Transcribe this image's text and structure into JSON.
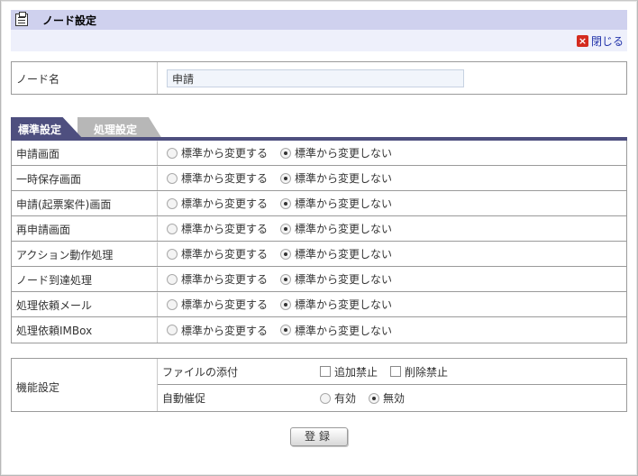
{
  "window": {
    "title": "ノード設定",
    "close_label": "閉じる"
  },
  "node": {
    "label": "ノード名",
    "value": "申請"
  },
  "tabs": [
    {
      "label": "標準設定",
      "active": true
    },
    {
      "label": "処理設定",
      "active": false
    }
  ],
  "standard": {
    "option_change": "標準から変更する",
    "option_nochange": "標準から変更しない",
    "rows": [
      {
        "label": "申請画面",
        "selected": "nochange"
      },
      {
        "label": "一時保存画面",
        "selected": "nochange"
      },
      {
        "label": "申請(起票案件)画面",
        "selected": "nochange"
      },
      {
        "label": "再申請画面",
        "selected": "nochange"
      },
      {
        "label": "アクション動作処理",
        "selected": "nochange"
      },
      {
        "label": "ノード到達処理",
        "selected": "nochange"
      },
      {
        "label": "処理依頼メール",
        "selected": "nochange"
      },
      {
        "label": "処理依頼IMBox",
        "selected": "nochange"
      }
    ]
  },
  "function": {
    "label": "機能設定",
    "attachment_label": "ファイルの添付",
    "add_forbid_label": "追加禁止",
    "delete_forbid_label": "削除禁止",
    "add_forbid_checked": false,
    "delete_forbid_checked": false,
    "reminder_label": "自動催促",
    "enabled_label": "有効",
    "disabled_label": "無効",
    "reminder_selected": "disabled"
  },
  "actions": {
    "register_label": "登録"
  }
}
